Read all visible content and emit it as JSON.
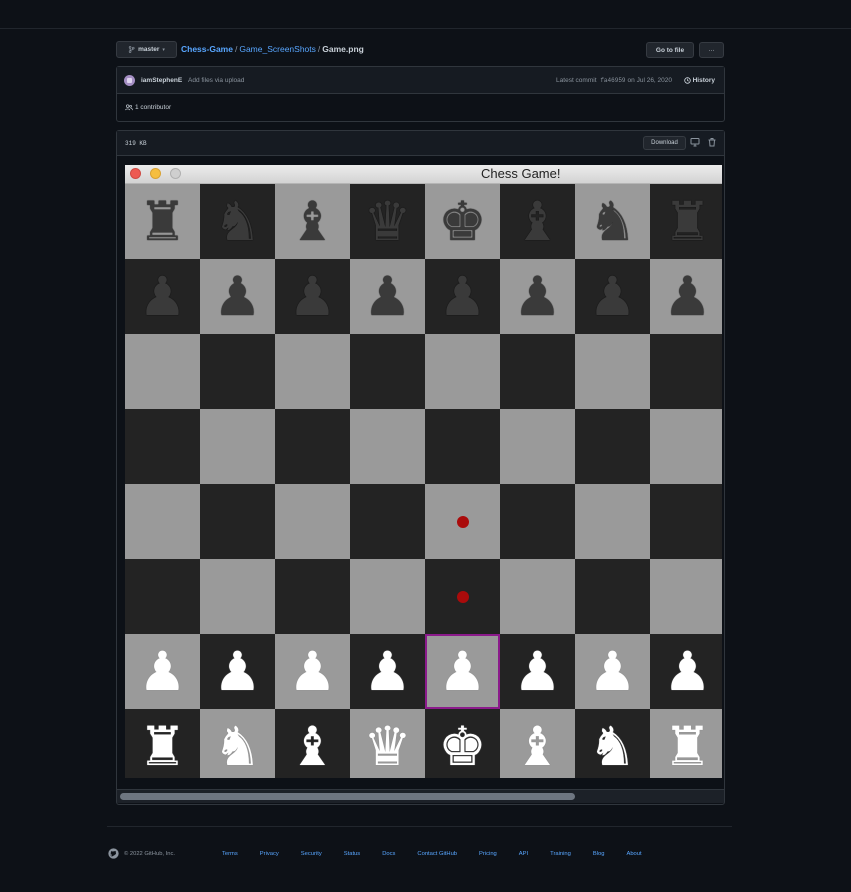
{
  "repo": {
    "branch": "master",
    "breadcrumb": [
      "Chess-Game",
      "Game_ScreenShots"
    ],
    "file": "Game.png",
    "goto_label": "Go to file",
    "more_label": "···"
  },
  "commit": {
    "author": "iamStephenE",
    "message": "Add files via upload",
    "latest_label": "Latest commit",
    "sha": "fa46959",
    "date_text": "on Jul 26, 2020",
    "history_label": "History"
  },
  "contributors": "1 contributor",
  "file": {
    "size": "319 KB",
    "download_label": "Download"
  },
  "game": {
    "window_title": "Chess Game!",
    "traffic_lights": [
      "#ed5a52",
      "#f5be3f",
      "#cfcfcf"
    ],
    "colors": {
      "light_square": "#9a9a9a",
      "dark_square": "#232323",
      "selected": "#8b1a8b",
      "move_dot": "#aa0b0b"
    },
    "board": [
      [
        "br",
        "bn",
        "bb",
        "bq",
        "bk",
        "bb",
        "bn",
        "br"
      ],
      [
        "bp",
        "bp",
        "bp",
        "bp",
        "bp",
        "bp",
        "bp",
        "bp"
      ],
      [
        "",
        "",
        "",
        "",
        "",
        "",
        "",
        ""
      ],
      [
        "",
        "",
        "",
        "",
        "",
        "",
        "",
        ""
      ],
      [
        "",
        "",
        "",
        "",
        "dot",
        "",
        "",
        ""
      ],
      [
        "",
        "",
        "",
        "",
        "dot",
        "",
        "",
        ""
      ],
      [
        "wp",
        "wp",
        "wp",
        "wp",
        "wp",
        "wp",
        "wp",
        "wp"
      ],
      [
        "wr",
        "wn",
        "wb",
        "wq",
        "wk",
        "wb",
        "wn",
        "wr"
      ]
    ],
    "selected": {
      "row": 6,
      "col": 4
    }
  },
  "footer": {
    "copyright": "© 2022 GitHub, Inc.",
    "links": [
      "Terms",
      "Privacy",
      "Security",
      "Status",
      "Docs",
      "Contact GitHub",
      "Pricing",
      "API",
      "Training",
      "Blog",
      "About"
    ]
  }
}
